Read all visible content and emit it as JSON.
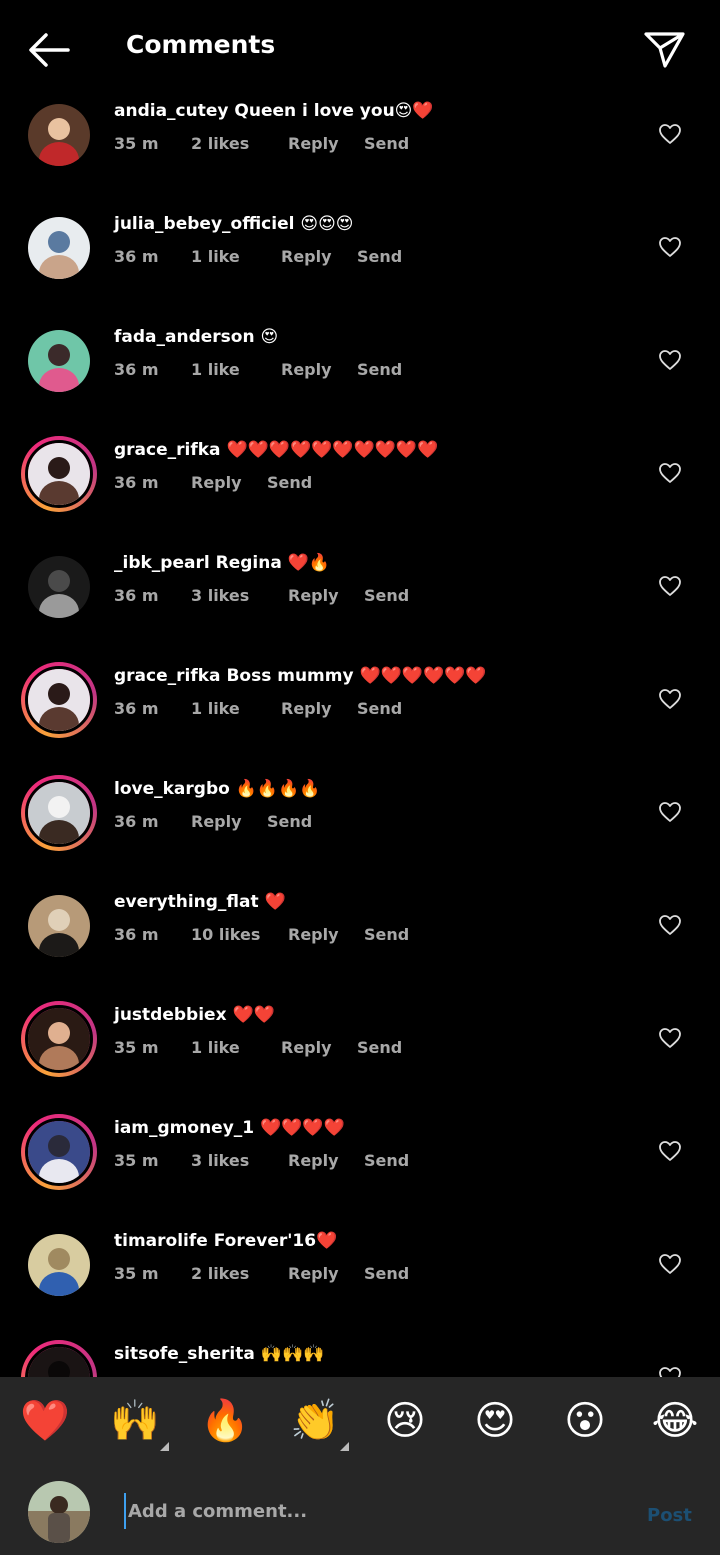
{
  "header": {
    "title": "Comments",
    "back_icon": "arrow-left-icon",
    "share_icon": "paper-plane-icon"
  },
  "comments": [
    {
      "user": "andia_cutey",
      "text": "Queen i love you😍❤️",
      "time": "35 m",
      "likes": "2 likes",
      "reply": "Reply",
      "send": "Send",
      "ring": false,
      "colors": [
        "#5a3a2a",
        "#c0282a",
        "#e9c2a0"
      ]
    },
    {
      "user": "julia_bebey_officiel",
      "text": "😍😍😍",
      "time": "36 m",
      "likes": "1 like",
      "reply": "Reply",
      "send": "Send",
      "ring": false,
      "colors": [
        "#e8ecef",
        "#c9a48a",
        "#5a7aa0"
      ]
    },
    {
      "user": "fada_anderson",
      "text": "😍",
      "time": "36 m",
      "likes": "1 like",
      "reply": "Reply",
      "send": "Send",
      "ring": false,
      "colors": [
        "#6fc6a8",
        "#e05a8e",
        "#3b2a2a"
      ]
    },
    {
      "user": "grace_rifka",
      "text": "❤️❤️❤️❤️❤️❤️❤️❤️❤️❤️",
      "time": "36 m",
      "likes": "",
      "reply": "Reply",
      "send": "Send",
      "ring": true,
      "colors": [
        "#e9e4ea",
        "#5a3a30",
        "#2a1a18"
      ]
    },
    {
      "user": "_ibk_pearl",
      "text": "Regina ❤️🔥",
      "time": "36 m",
      "likes": "3 likes",
      "reply": "Reply",
      "send": "Send",
      "ring": false,
      "colors": [
        "#1a1a1a",
        "#9a9a9a",
        "#4a4a4a"
      ]
    },
    {
      "user": "grace_rifka",
      "text": "Boss mummy ❤️❤️❤️❤️❤️❤️",
      "time": "36 m",
      "likes": "1 like",
      "reply": "Reply",
      "send": "Send",
      "ring": true,
      "colors": [
        "#e9e4ea",
        "#5a3a30",
        "#2a1a18"
      ]
    },
    {
      "user": "love_kargbo",
      "text": "🔥🔥🔥🔥",
      "time": "36 m",
      "likes": "",
      "reply": "Reply",
      "send": "Send",
      "ring": true,
      "colors": [
        "#c8ccd0",
        "#3a2a22",
        "#f2f2f2"
      ]
    },
    {
      "user": "everything_flat",
      "text": "❤️",
      "time": "36 m",
      "likes": "10 likes",
      "reply": "Reply",
      "send": "Send",
      "ring": false,
      "colors": [
        "#b79a78",
        "#1c1a18",
        "#e0d0b8"
      ]
    },
    {
      "user": "justdebbiex",
      "text": "❤️❤️",
      "time": "35 m",
      "likes": "1 like",
      "reply": "Reply",
      "send": "Send",
      "ring": true,
      "colors": [
        "#2a1a14",
        "#b07a5a",
        "#e0b090"
      ]
    },
    {
      "user": "iam_gmoney_1",
      "text": "❤️❤️❤️❤️",
      "time": "35 m",
      "likes": "3 likes",
      "reply": "Reply",
      "send": "Send",
      "ring": true,
      "colors": [
        "#3a4a8a",
        "#e8e8f0",
        "#2a2a3a"
      ]
    },
    {
      "user": "timarolife",
      "text": "Forever'16❤️",
      "time": "35 m",
      "likes": "2 likes",
      "reply": "Reply",
      "send": "Send",
      "ring": false,
      "colors": [
        "#d8cca0",
        "#3060b0",
        "#a08a60"
      ]
    },
    {
      "user": "sitsofe_sherita",
      "text": "🙌🙌🙌",
      "time": "",
      "likes": "",
      "reply": "",
      "send": "",
      "ring": true,
      "colors": [
        "#1a1414",
        "#5a4038",
        "#0a0808"
      ]
    }
  ],
  "reactions": [
    {
      "emoji": "❤️",
      "icon": "red-heart-emoji",
      "more": false
    },
    {
      "emoji": "🙌",
      "icon": "raising-hands-emoji",
      "more": true
    },
    {
      "emoji": "🔥",
      "icon": "fire-emoji",
      "more": false
    },
    {
      "emoji": "👏",
      "icon": "clapping-hands-emoji",
      "more": true
    },
    {
      "emoji": "😢",
      "icon": "crying-face-emoji",
      "more": false
    },
    {
      "emoji": "😍",
      "icon": "heart-eyes-emoji",
      "more": false
    },
    {
      "emoji": "😮",
      "icon": "surprised-face-emoji",
      "more": false
    },
    {
      "emoji": "😂",
      "icon": "tears-of-joy-emoji",
      "more": false
    }
  ],
  "composer": {
    "placeholder": "Add a comment...",
    "post_label": "Post",
    "post_color": "#1c4f73"
  },
  "colors": {
    "background": "#000000",
    "bar": "#262626",
    "meta_text": "#a8a8a8",
    "ring_start": "#f9a23a",
    "ring_end": "#c13584"
  }
}
